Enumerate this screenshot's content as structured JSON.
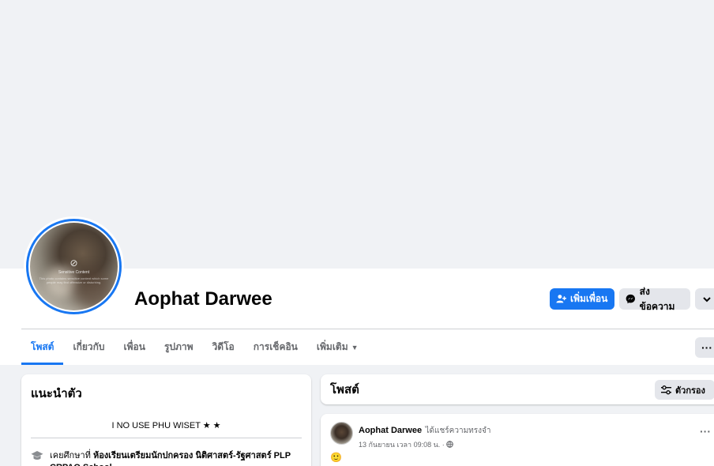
{
  "profile": {
    "name": "Aophat Darwee",
    "avatar_overlay_title": "Sensitive Content",
    "avatar_overlay_text": "This photo contains sensitive content which some people may find offensive or disturbing."
  },
  "actions": {
    "add_friend": "เพิ่มเพื่อน",
    "message": "ส่งข้อความ",
    "more_icon": "chevron-down-icon"
  },
  "tabs": [
    {
      "label": "โพสต์",
      "active": true
    },
    {
      "label": "เกี่ยวกับ",
      "active": false
    },
    {
      "label": "เพื่อน",
      "active": false
    },
    {
      "label": "รูปภาพ",
      "active": false
    },
    {
      "label": "วิดีโอ",
      "active": false
    },
    {
      "label": "การเช็คอิน",
      "active": false
    },
    {
      "label": "เพิ่มเติม",
      "active": false
    }
  ],
  "intro": {
    "title": "แนะนำตัว",
    "bio": "I NO USE PHU WISET ★ ★",
    "edu_prefix": "เคยศึกษาที่ ",
    "edu_school": "ห้องเรียนเตรียมนักปกครอง นิติศาสตร์-รัฐศาสตร์ PLP CRPAO School"
  },
  "posts_section": {
    "title": "โพสต์",
    "filter_label": "ตัวกรอง"
  },
  "post": {
    "author": "Aophat Darwee",
    "action": "ได้แชร์ความทรงจำ",
    "time": "13 กันยายน เวลา 09:08 น. ·",
    "emoji": "🙂"
  },
  "colors": {
    "accent": "#1877f2",
    "page_bg": "#f0f2f5",
    "button_gray": "#e4e6eb",
    "muted_text": "#65676b"
  }
}
